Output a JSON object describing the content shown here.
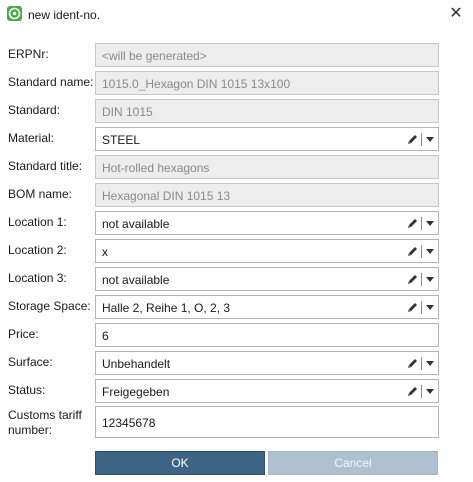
{
  "window": {
    "title": "new ident-no.",
    "close_glyph": "✕",
    "icon": "app-logo-icon"
  },
  "fields": {
    "erpnr": {
      "label": "ERPNr:",
      "value": "<will be generated>",
      "readonly": true
    },
    "standard_name": {
      "label": "Standard name:",
      "value": "1015.0_Hexagon DIN 1015 13x100",
      "readonly": true
    },
    "standard": {
      "label": "Standard:",
      "value": "DIN 1015",
      "readonly": true
    },
    "material": {
      "label": "Material:",
      "value": "STEEL",
      "editable_dropdown": true
    },
    "standard_title": {
      "label": "Standard title:",
      "value": "Hot-rolled hexagons",
      "readonly": true
    },
    "bom_name": {
      "label": "BOM name:",
      "value": "Hexagonal DIN 1015 13",
      "readonly": true
    },
    "location1": {
      "label": "Location 1:",
      "value": "not available",
      "editable_dropdown": true
    },
    "location2": {
      "label": "Location 2:",
      "value": "x",
      "editable_dropdown": true
    },
    "location3": {
      "label": "Location 3:",
      "value": "not available",
      "editable_dropdown": true
    },
    "storage_space": {
      "label": "Storage Space:",
      "value": "Halle 2, Reihe 1, O, 2, 3",
      "editable_dropdown": true
    },
    "price": {
      "label": "Price:",
      "value": "6"
    },
    "surface": {
      "label": "Surface:",
      "value": "Unbehandelt",
      "editable_dropdown": true
    },
    "status": {
      "label": "Status:",
      "value": "Freigegeben",
      "editable_dropdown": true
    },
    "customs_tariff": {
      "label": "Customs tariff number:",
      "value": "12345678"
    }
  },
  "buttons": {
    "ok": "OK",
    "cancel": "Cancel"
  },
  "colors": {
    "ok_button": "#3e6485",
    "cancel_button_disabled": "#afc1d1",
    "readonly_field": "#ededed"
  },
  "icons": {
    "edit": "pencil-icon",
    "dropdown": "chevron-down-icon"
  }
}
